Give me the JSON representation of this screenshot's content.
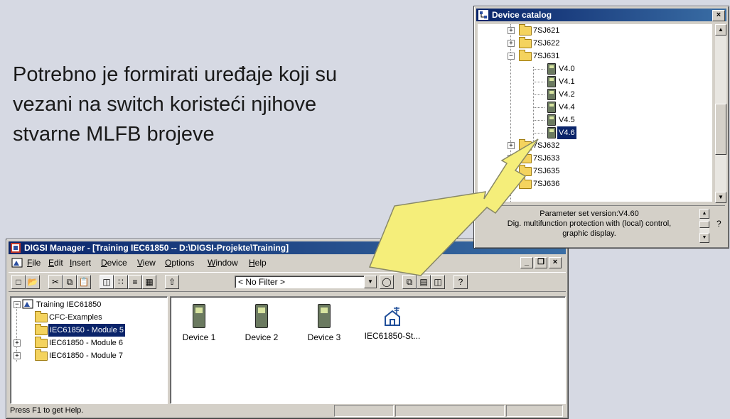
{
  "slide": {
    "lines": [
      "Potrebno je formirati uređaje koji su",
      "vezani na switch koristeći njihove",
      "stvarne MLFB brojeve"
    ]
  },
  "colors": {
    "arrow_fill": "#f5ee7a",
    "arrow_stroke": "#888866",
    "titlebar": "#0a246a",
    "selection": "#0a246a"
  },
  "catalog": {
    "title": "Device catalog",
    "close": "×",
    "tree": [
      {
        "label": "7SJ621",
        "type": "folder",
        "expander": "+"
      },
      {
        "label": "7SJ622",
        "type": "folder",
        "expander": "+"
      },
      {
        "label": "7SJ631",
        "type": "folder",
        "expander": "−"
      },
      {
        "label": "V4.0",
        "type": "device"
      },
      {
        "label": "V4.1",
        "type": "device"
      },
      {
        "label": "V4.2",
        "type": "device"
      },
      {
        "label": "V4.4",
        "type": "device"
      },
      {
        "label": "V4.5",
        "type": "device"
      },
      {
        "label": "V4.6",
        "type": "device",
        "selected": true
      },
      {
        "label": "7SJ632",
        "type": "folder",
        "expander": "+"
      },
      {
        "label": "7SJ633",
        "type": "folder",
        "expander": "+"
      },
      {
        "label": "7SJ635",
        "type": "folder",
        "expander": "+"
      },
      {
        "label": "7SJ636",
        "type": "folder",
        "expander": "+"
      }
    ],
    "info": {
      "line1": "Parameter set version:V4.60",
      "line2": "Dig. multifunction protection with (local) control,",
      "line3": "graphic display."
    },
    "help": "?"
  },
  "digsi": {
    "title": "DIGSI Manager - [Training IEC61850 -- D:\\DIGSI-Projekte\\Training]",
    "menu": [
      "File",
      "Edit",
      "Insert",
      "Device",
      "View",
      "Options",
      "Window",
      "Help"
    ],
    "mdi_buttons": [
      "_",
      "❒",
      "×"
    ],
    "filter": "< No Filter >",
    "tree": [
      {
        "label": "Training IEC61850",
        "level": 0,
        "expander": "−"
      },
      {
        "label": "CFC-Examples",
        "level": 1
      },
      {
        "label": "IEC61850 - Module 5",
        "level": 1,
        "selected": true
      },
      {
        "label": "IEC61850 - Module 6",
        "level": 1,
        "expander": "+"
      },
      {
        "label": "IEC61850 - Module 7",
        "level": 1,
        "expander": "+"
      }
    ],
    "devices": [
      "Device 1",
      "Device 2",
      "Device 3",
      "IEC61850-St..."
    ],
    "status": "Press F1 to get Help."
  }
}
